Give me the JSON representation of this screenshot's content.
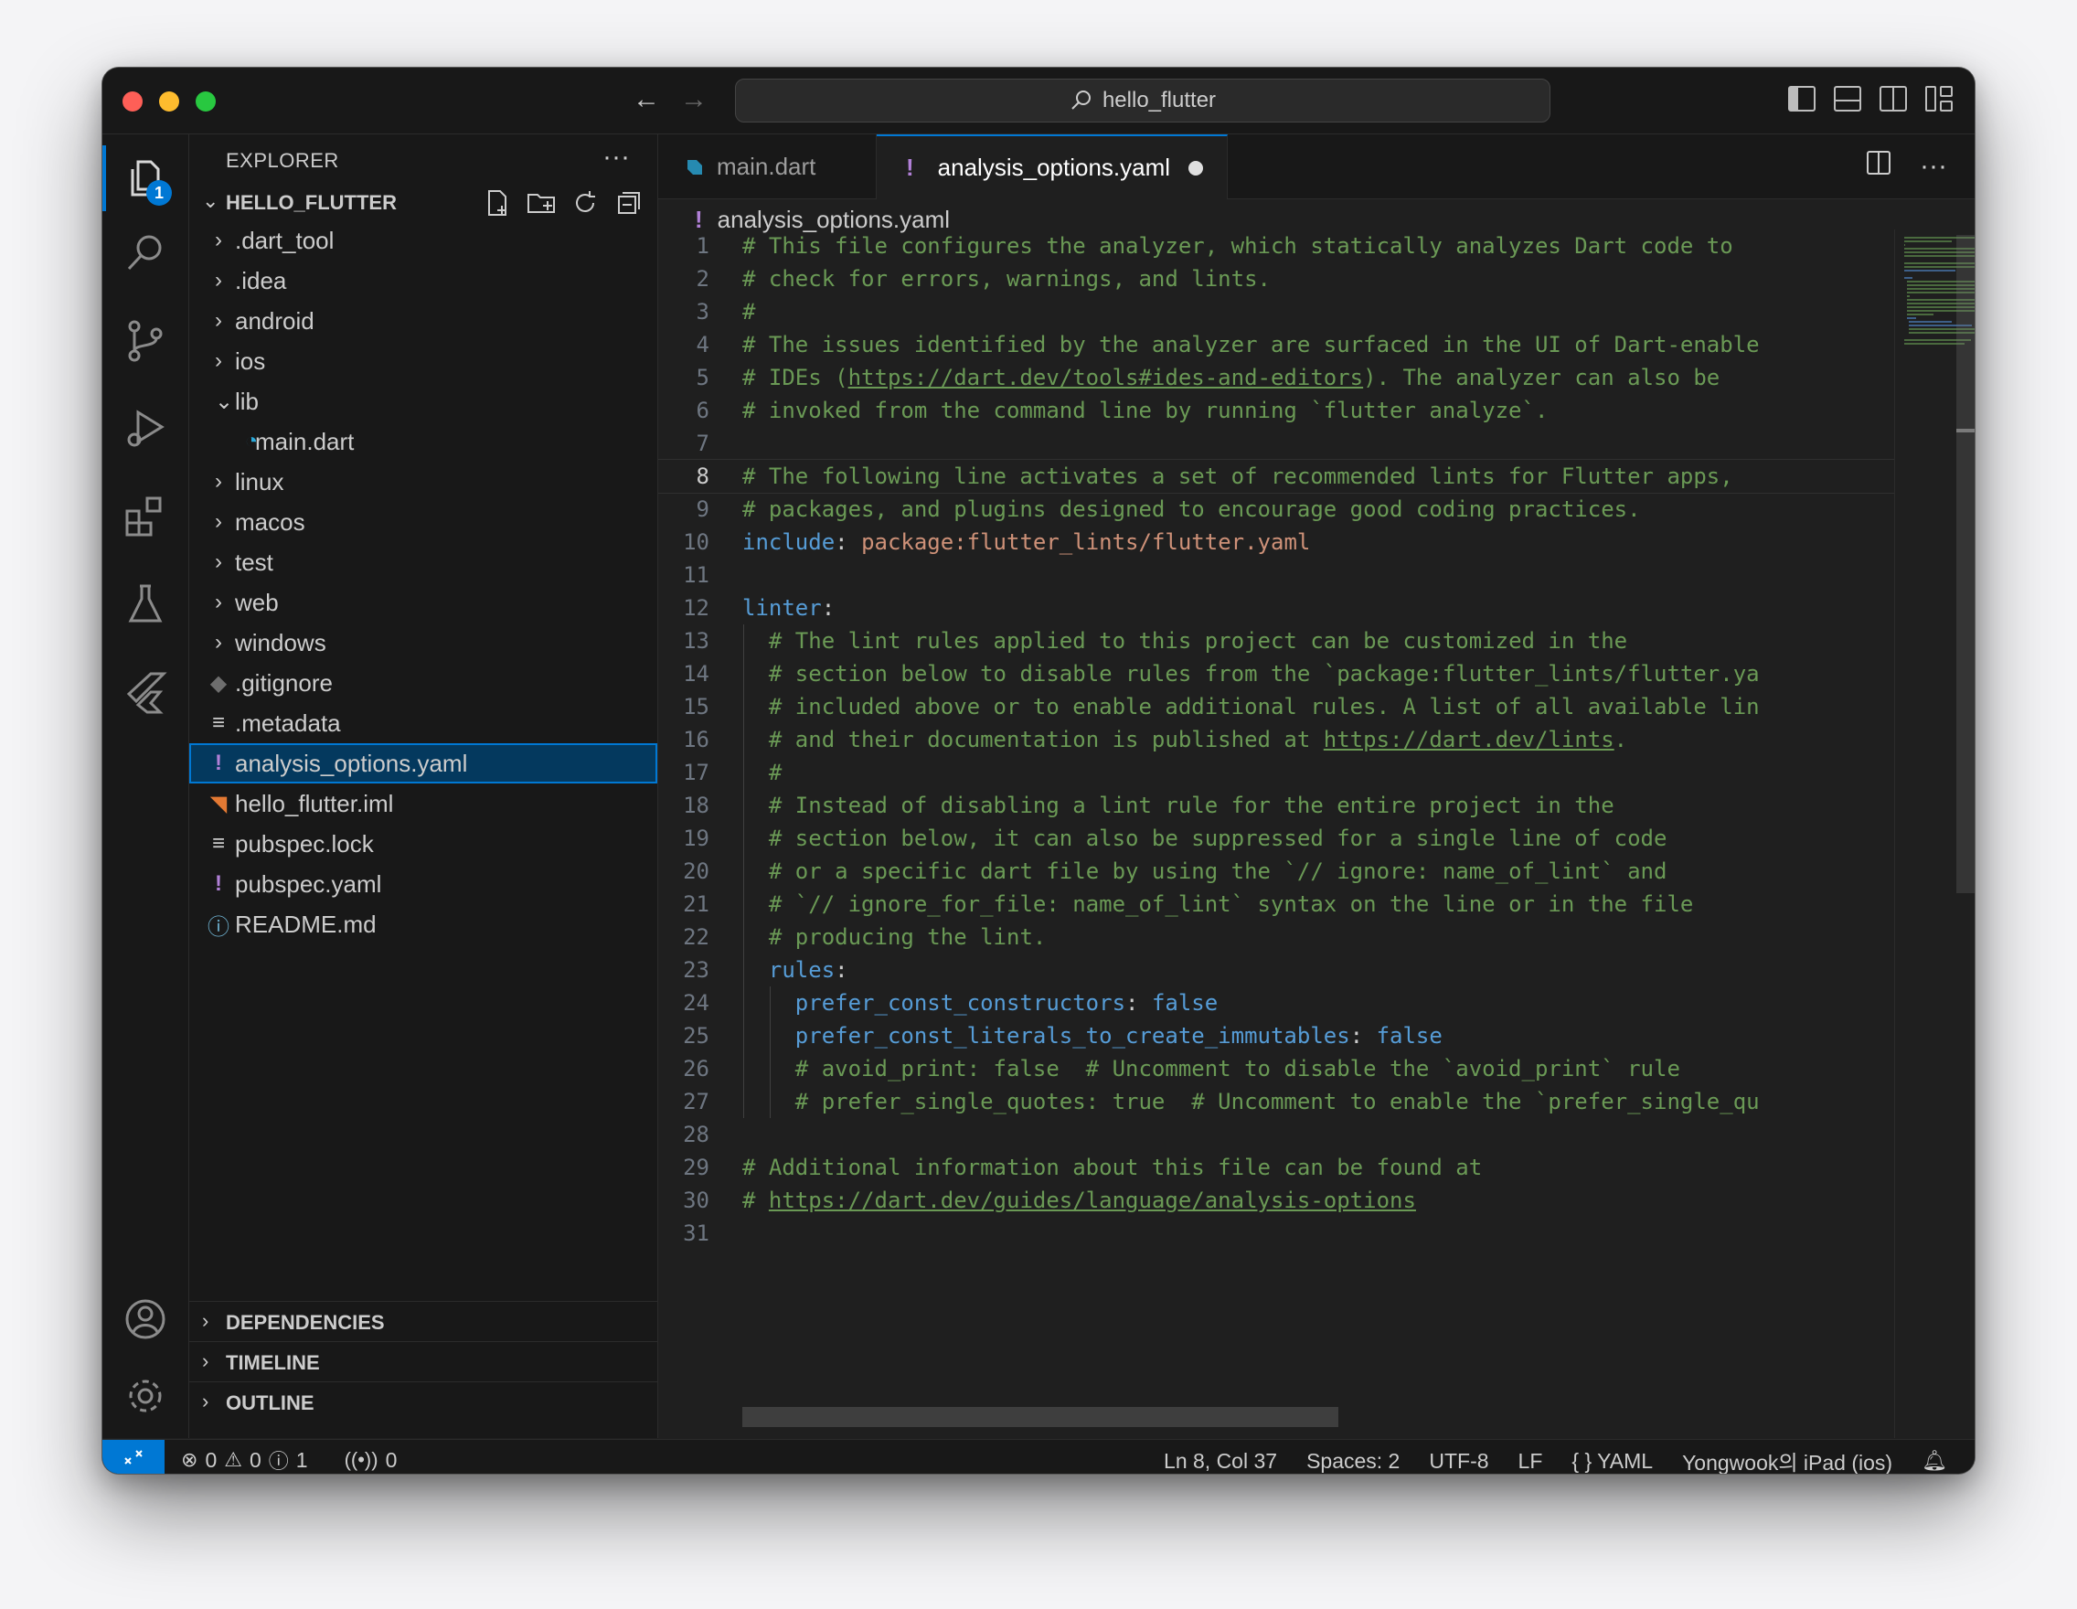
{
  "titlebar": {
    "search_text": "hello_flutter"
  },
  "activity": {
    "explorer_badge": "1"
  },
  "sidebar": {
    "title": "EXPLORER",
    "more": "···",
    "project_name": "HELLO_FLUTTER",
    "tree": [
      {
        "label": ".dart_tool",
        "kind": "folder",
        "depth": 0,
        "open": false
      },
      {
        "label": ".idea",
        "kind": "folder",
        "depth": 0,
        "open": false
      },
      {
        "label": "android",
        "kind": "folder",
        "depth": 0,
        "open": false
      },
      {
        "label": "ios",
        "kind": "folder",
        "depth": 0,
        "open": false
      },
      {
        "label": "lib",
        "kind": "folder",
        "depth": 0,
        "open": true
      },
      {
        "label": "main.dart",
        "kind": "dart",
        "depth": 1
      },
      {
        "label": "linux",
        "kind": "folder",
        "depth": 0,
        "open": false
      },
      {
        "label": "macos",
        "kind": "folder",
        "depth": 0,
        "open": false
      },
      {
        "label": "test",
        "kind": "folder",
        "depth": 0,
        "open": false
      },
      {
        "label": "web",
        "kind": "folder",
        "depth": 0,
        "open": false
      },
      {
        "label": "windows",
        "kind": "folder",
        "depth": 0,
        "open": false
      },
      {
        "label": ".gitignore",
        "kind": "git",
        "depth": 0
      },
      {
        "label": ".metadata",
        "kind": "lines",
        "depth": 0
      },
      {
        "label": "analysis_options.yaml",
        "kind": "yaml",
        "depth": 0,
        "selected": true
      },
      {
        "label": "hello_flutter.iml",
        "kind": "rss",
        "depth": 0
      },
      {
        "label": "pubspec.lock",
        "kind": "lines",
        "depth": 0
      },
      {
        "label": "pubspec.yaml",
        "kind": "yaml",
        "depth": 0
      },
      {
        "label": "README.md",
        "kind": "info",
        "depth": 0
      }
    ],
    "sections": [
      "OUTLINE",
      "TIMELINE",
      "DEPENDENCIES"
    ]
  },
  "editor": {
    "tabs": [
      {
        "label": "main.dart",
        "active": false
      },
      {
        "label": "analysis_options.yaml",
        "active": true,
        "dirty": true
      }
    ],
    "breadcrumb": "analysis_options.yaml",
    "active_line": 8,
    "lines": [
      [
        [
          "c",
          "# This file configures the analyzer, which statically analyzes Dart code to"
        ]
      ],
      [
        [
          "c",
          "# check for errors, warnings, and lints."
        ]
      ],
      [
        [
          "c",
          "#"
        ]
      ],
      [
        [
          "c",
          "# The issues identified by the analyzer are surfaced in the UI of Dart-enable"
        ]
      ],
      [
        [
          "c",
          "# IDEs ("
        ],
        [
          "l",
          "https://dart.dev/tools#ides-and-editors"
        ],
        [
          "c",
          "). The analyzer can also be"
        ]
      ],
      [
        [
          "c",
          "# invoked from the command line by running `flutter analyze`."
        ]
      ],
      [],
      [
        [
          "c",
          "# The following line activates a set of recommended lints for Flutter apps,"
        ]
      ],
      [
        [
          "c",
          "# packages, and plugins designed to encourage good coding practices."
        ]
      ],
      [
        [
          "k",
          "include"
        ],
        [
          "p",
          ": "
        ],
        [
          "s",
          "package:flutter_lints/flutter.yaml"
        ]
      ],
      [],
      [
        [
          "k",
          "linter"
        ],
        [
          "p",
          ":"
        ]
      ],
      [
        [
          "i",
          "  "
        ],
        [
          "c",
          "# The lint rules applied to this project can be customized in the"
        ]
      ],
      [
        [
          "i",
          "  "
        ],
        [
          "c",
          "# section below to disable rules from the `package:flutter_lints/flutter.ya"
        ]
      ],
      [
        [
          "i",
          "  "
        ],
        [
          "c",
          "# included above or to enable additional rules. A list of all available lin"
        ]
      ],
      [
        [
          "i",
          "  "
        ],
        [
          "c",
          "# and their documentation is published at "
        ],
        [
          "l",
          "https://dart.dev/lints"
        ],
        [
          "c",
          "."
        ]
      ],
      [
        [
          "i",
          "  "
        ],
        [
          "c",
          "#"
        ]
      ],
      [
        [
          "i",
          "  "
        ],
        [
          "c",
          "# Instead of disabling a lint rule for the entire project in the"
        ]
      ],
      [
        [
          "i",
          "  "
        ],
        [
          "c",
          "# section below, it can also be suppressed for a single line of code"
        ]
      ],
      [
        [
          "i",
          "  "
        ],
        [
          "c",
          "# or a specific dart file by using the `// ignore: name_of_lint` and"
        ]
      ],
      [
        [
          "i",
          "  "
        ],
        [
          "c",
          "# `// ignore_for_file: name_of_lint` syntax on the line or in the file"
        ]
      ],
      [
        [
          "i",
          "  "
        ],
        [
          "c",
          "# producing the lint."
        ]
      ],
      [
        [
          "i",
          "  "
        ],
        [
          "k",
          "rules"
        ],
        [
          "p",
          ":"
        ]
      ],
      [
        [
          "i",
          "    "
        ],
        [
          "k",
          "prefer_const_constructors"
        ],
        [
          "p",
          ": "
        ],
        [
          "b",
          "false"
        ]
      ],
      [
        [
          "i",
          "    "
        ],
        [
          "k",
          "prefer_const_literals_to_create_immutables"
        ],
        [
          "p",
          ": "
        ],
        [
          "b",
          "false"
        ]
      ],
      [
        [
          "i",
          "    "
        ],
        [
          "c",
          "# avoid_print: false  # Uncomment to disable the `avoid_print` rule"
        ]
      ],
      [
        [
          "i",
          "    "
        ],
        [
          "c",
          "# prefer_single_quotes: true  # Uncomment to enable the `prefer_single_qu"
        ]
      ],
      [],
      [
        [
          "c",
          "# Additional information about this file can be found at"
        ]
      ],
      [
        [
          "c",
          "# "
        ],
        [
          "l",
          "https://dart.dev/guides/language/analysis-options"
        ]
      ],
      []
    ]
  },
  "status": {
    "errors": "0",
    "warnings": "0",
    "infos": "1",
    "ports": "0",
    "position": "Ln 8, Col 37",
    "spaces": "Spaces: 2",
    "encoding": "UTF-8",
    "eol": "LF",
    "language": "YAML",
    "device": "Yongwook의 iPad (ios)"
  }
}
